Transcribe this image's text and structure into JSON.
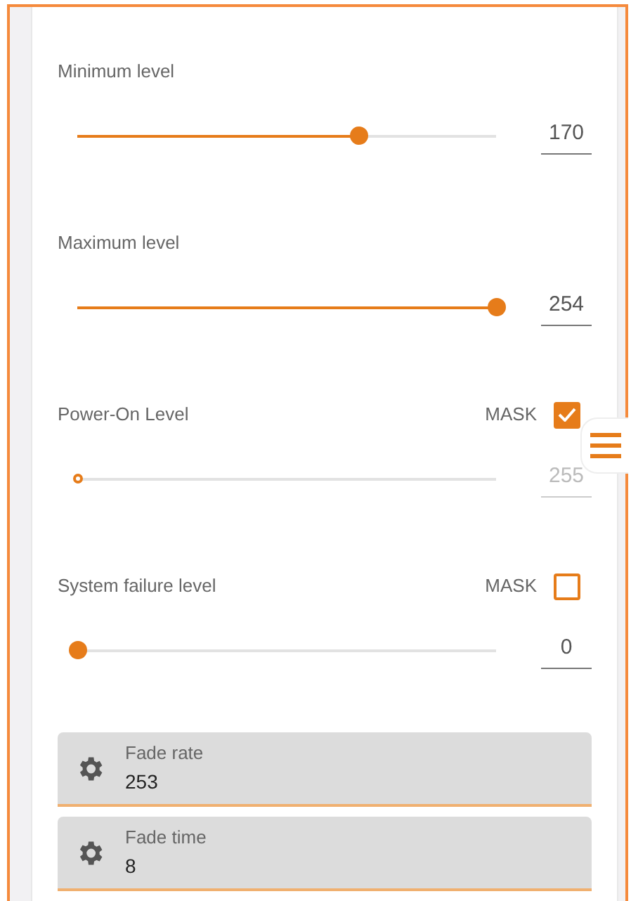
{
  "levels": [
    {
      "label": "Minimum level",
      "level": 0.67,
      "value": "170",
      "disabled": false
    },
    {
      "label": "Maximum level",
      "level": 1.0,
      "value": "254",
      "disabled": false
    },
    {
      "label": "Power-On Level",
      "mask": {
        "label": "MASK",
        "checked": true
      },
      "level": 0,
      "value": "255",
      "disabled": true
    },
    {
      "label": "System failure level",
      "mask": {
        "label": "MASK",
        "checked": false
      },
      "level": 0,
      "value": "0",
      "disabled": false
    }
  ],
  "settings": [
    {
      "label": "Fade rate",
      "value": "253"
    },
    {
      "label": "Fade time",
      "value": "8"
    }
  ]
}
